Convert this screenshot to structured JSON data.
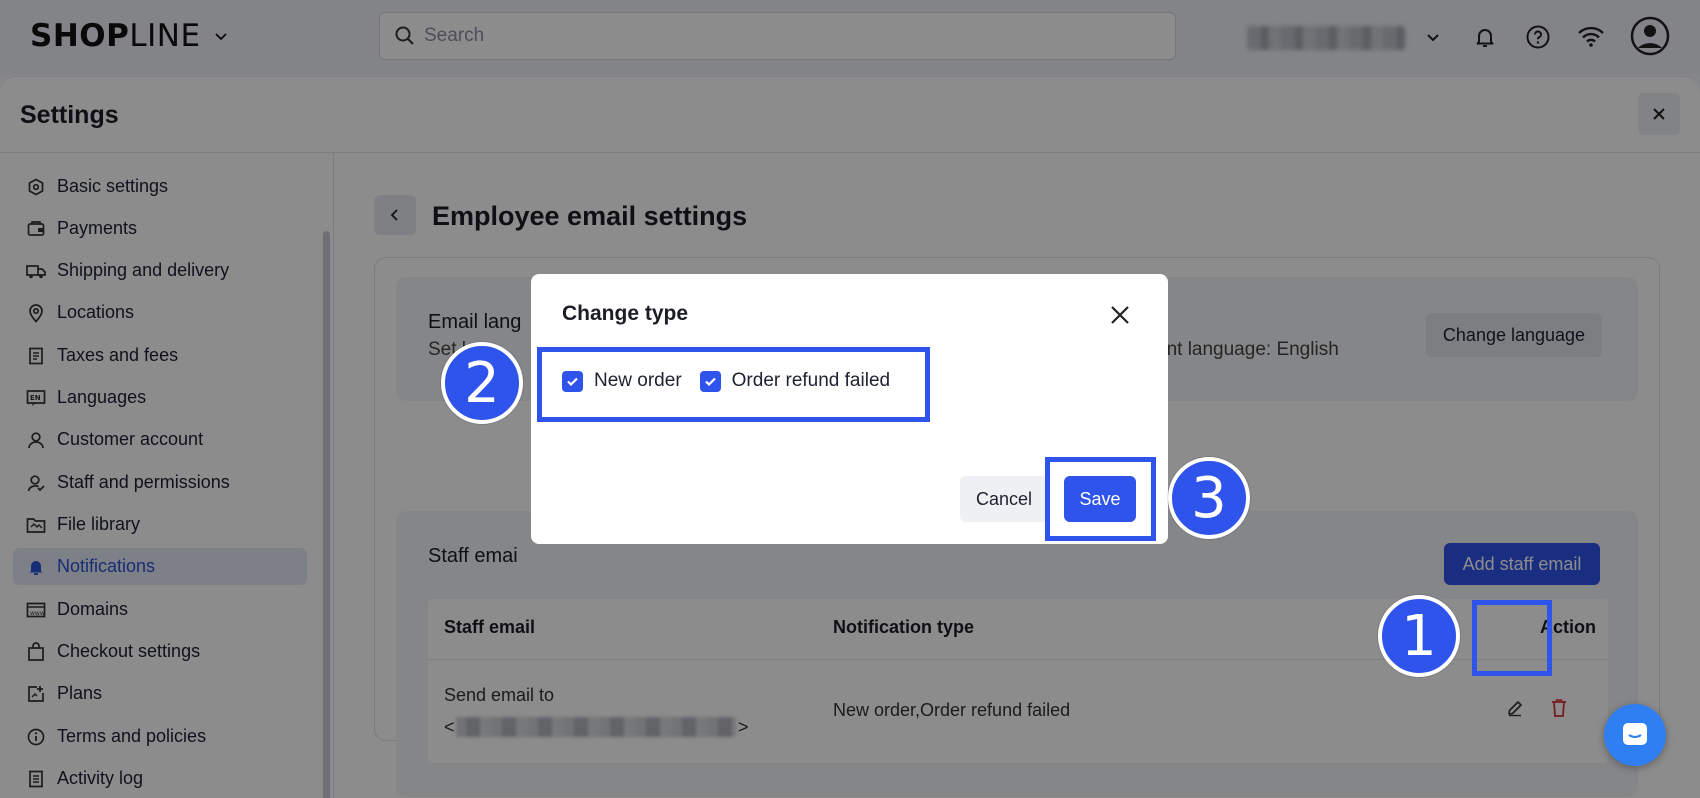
{
  "topbar": {
    "logo_bold": "SHOP",
    "logo_light": "LINE",
    "search_placeholder": "Search",
    "icons": [
      "chevron-down-icon",
      "bell-icon",
      "help-icon",
      "wifi-icon",
      "user-avatar-icon"
    ]
  },
  "settings": {
    "title": "Settings",
    "nav": [
      {
        "label": "Basic settings",
        "icon": "basic-settings-icon"
      },
      {
        "label": "Payments",
        "icon": "payments-icon"
      },
      {
        "label": "Shipping and delivery",
        "icon": "truck-icon"
      },
      {
        "label": "Locations",
        "icon": "location-pin-icon"
      },
      {
        "label": "Taxes and fees",
        "icon": "receipt-icon"
      },
      {
        "label": "Languages",
        "icon": "language-icon"
      },
      {
        "label": "Customer account",
        "icon": "person-icon"
      },
      {
        "label": "Staff and permissions",
        "icon": "staff-icon"
      },
      {
        "label": "File library",
        "icon": "folder-icon"
      },
      {
        "label": "Notifications",
        "icon": "bell-icon",
        "active": true
      },
      {
        "label": "Domains",
        "icon": "domain-icon"
      },
      {
        "label": "Checkout settings",
        "icon": "bag-icon"
      },
      {
        "label": "Plans",
        "icon": "plans-icon"
      },
      {
        "label": "Terms and policies",
        "icon": "info-icon"
      },
      {
        "label": "Activity log",
        "icon": "log-icon"
      }
    ]
  },
  "page": {
    "title": "Employee email settings",
    "language_card": {
      "title": "Email lang",
      "subtitle": "Set lang",
      "current": "ent language: English",
      "button": "Change language"
    },
    "staff_card": {
      "title": "Staff emai",
      "button": "Add staff email",
      "table": {
        "headers": [
          "Staff email",
          "Notification type",
          "Action"
        ],
        "rows": [
          {
            "email_prefix": "Send email to",
            "email_open": "<",
            "email_close": ">",
            "type": "New order,Order refund failed"
          }
        ]
      }
    }
  },
  "modal": {
    "title": "Change type",
    "options": [
      {
        "label": "New order",
        "checked": true
      },
      {
        "label": "Order refund failed",
        "checked": true
      }
    ],
    "cancel": "Cancel",
    "save": "Save"
  },
  "annotations": {
    "step1": "1",
    "step2": "2",
    "step3": "3",
    "color": "#2f54eb"
  },
  "colors": {
    "primary": "#2f54eb",
    "nav_active_bg": "#e4e9f5",
    "delete_red": "#d9363e"
  }
}
